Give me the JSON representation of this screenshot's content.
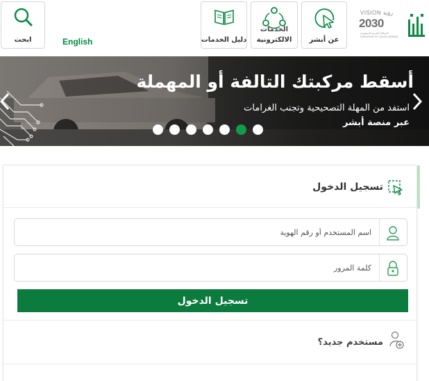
{
  "header": {
    "search_label": "ابحث",
    "english_label": "English",
    "guide_label": "دليل الخدمات",
    "eservices_label_top": "الخدمات",
    "eservices_label": "الالكترونية",
    "about_label": "عن أبشر",
    "vision_title": "VISION رؤية",
    "vision_year": "2030",
    "vision_sub": "المملكة العربية السعودية KINGDOM OF SAUDI ARABIA",
    "brand_color": "#008940"
  },
  "banner": {
    "title": "أسقط مركبتك التالفة أو المهملة",
    "subtitle": "استفد من المهلة التصحيحية وتجنب الغرامات",
    "link": "عبر منصة أبشر",
    "slides_total": 7,
    "active_slide": 6,
    "active_color": "#129b4a"
  },
  "login": {
    "title": "تسجيل الدخول",
    "username_placeholder": "اسم المستخدم أو رقم الهوية",
    "password_placeholder": "كلمة المرور",
    "submit_label": "تسجيل الدخول",
    "new_user_label": "مستخدم جديد؟",
    "button_color": "#0b7c3e"
  },
  "icons": {
    "search": "search-icon",
    "guide": "book-icon",
    "eservices": "network-icon",
    "about": "cursor-icon",
    "login": "cursor-click-icon",
    "user": "user-icon",
    "lock": "lock-icon",
    "add_user": "add-user-icon"
  }
}
